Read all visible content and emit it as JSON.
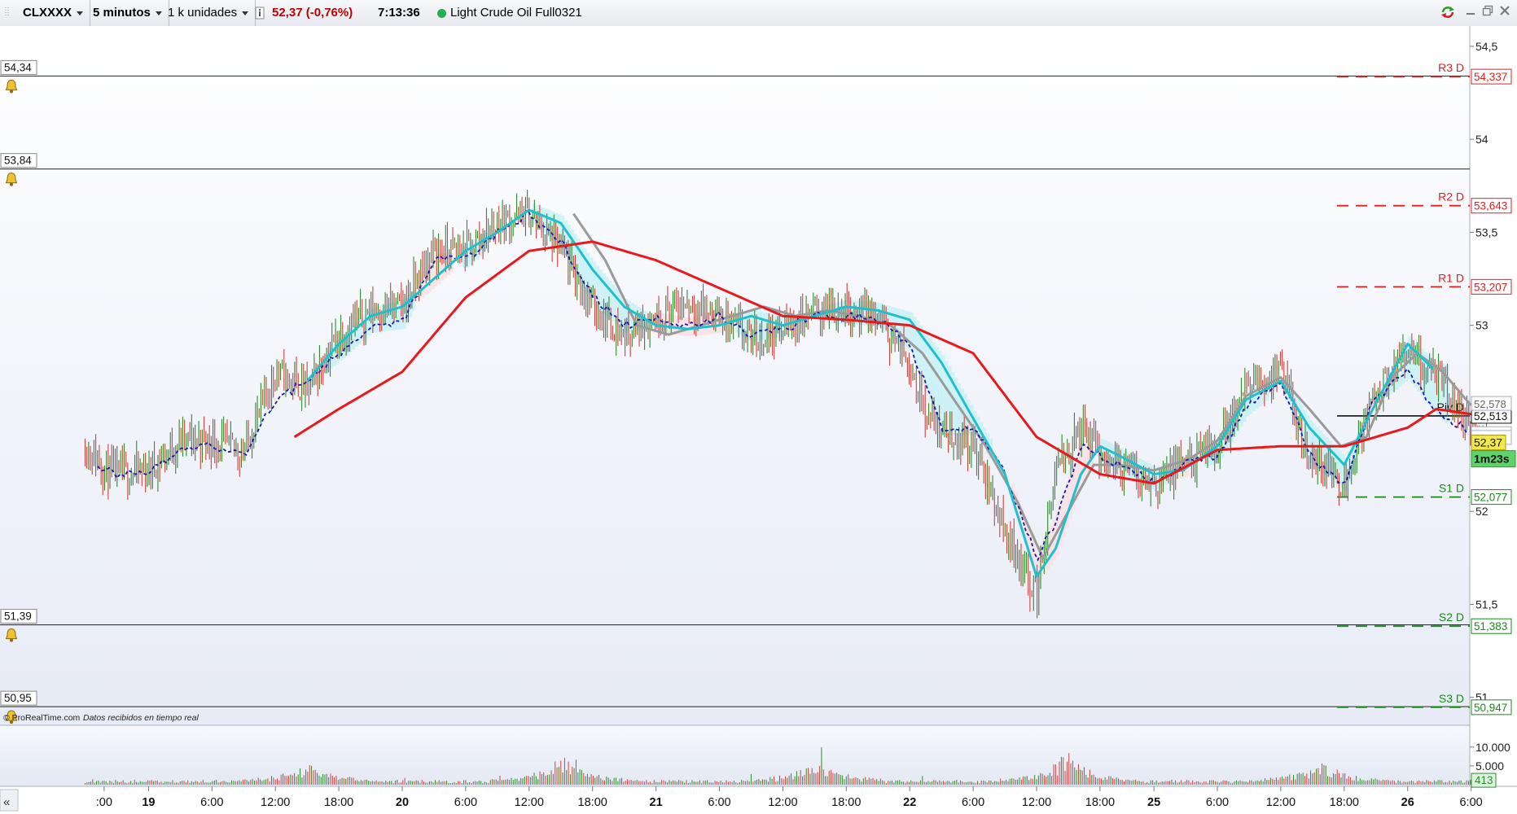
{
  "toolbar": {
    "symbol": "CLXXXX",
    "interval": "5 minutos",
    "units": "1 k unidades",
    "price_change": "52,37 (-0,76%)",
    "time": "7:13:36",
    "instrument": "Light Crude Oil Full0321"
  },
  "footer": {
    "brand": "© ProRealTime.com",
    "status": "Datos recibidos en tiempo real",
    "timer": "1m23s"
  },
  "colors": {
    "bull": "#2e8b2e",
    "bear": "#d04040",
    "cyan": "#1fc0cc",
    "red_ma": "#e8191c",
    "gray_ma": "#9a9a9a",
    "blue_dash": "#1a1aa8",
    "resistance": "#e02020",
    "support": "#1a8a1a"
  },
  "chart_data": {
    "type": "line",
    "title": "Light Crude Oil Full0321",
    "ylim": [
      50.85,
      54.6
    ],
    "y_ticks": [
      {
        "v": 54.5,
        "label": "54,5"
      },
      {
        "v": 54,
        "label": "54"
      },
      {
        "v": 53.5,
        "label": "53,5"
      },
      {
        "v": 53,
        "label": "53"
      },
      {
        "v": 52,
        "label": "52"
      },
      {
        "v": 51.5,
        "label": "51,5"
      },
      {
        "v": 51,
        "label": "51"
      }
    ],
    "x_ticks": [
      {
        "x": 0.3,
        "label": ":00",
        "bold": false
      },
      {
        "x": 1,
        "label": "19",
        "bold": true
      },
      {
        "x": 2,
        "label": "6:00",
        "bold": false
      },
      {
        "x": 3,
        "label": "12:00",
        "bold": false
      },
      {
        "x": 4,
        "label": "18:00",
        "bold": false
      },
      {
        "x": 5,
        "label": "20",
        "bold": true
      },
      {
        "x": 6,
        "label": "6:00",
        "bold": false
      },
      {
        "x": 7,
        "label": "12:00",
        "bold": false
      },
      {
        "x": 8,
        "label": "18:00",
        "bold": false
      },
      {
        "x": 9,
        "label": "21",
        "bold": true
      },
      {
        "x": 10,
        "label": "6:00",
        "bold": false
      },
      {
        "x": 11,
        "label": "12:00",
        "bold": false
      },
      {
        "x": 12,
        "label": "18:00",
        "bold": false
      },
      {
        "x": 13,
        "label": "22",
        "bold": true
      },
      {
        "x": 14,
        "label": "6:00",
        "bold": false
      },
      {
        "x": 15,
        "label": "12:00",
        "bold": false
      },
      {
        "x": 16,
        "label": "18:00",
        "bold": false
      },
      {
        "x": 16.85,
        "label": "25",
        "bold": true
      },
      {
        "x": 17.85,
        "label": "6:00",
        "bold": false
      },
      {
        "x": 18.85,
        "label": "12:00",
        "bold": false
      },
      {
        "x": 19.85,
        "label": "18:00",
        "bold": false
      },
      {
        "x": 20.85,
        "label": "26",
        "bold": true
      },
      {
        "x": 21.85,
        "label": "6:00",
        "bold": false
      }
    ],
    "alert_lines": [
      {
        "value": 54.34,
        "label": "54,34"
      },
      {
        "value": 53.84,
        "label": "53,84"
      },
      {
        "value": 51.39,
        "label": "51,39"
      },
      {
        "value": 50.95,
        "label": "50,95"
      }
    ],
    "pivot_levels": [
      {
        "name": "R3 D",
        "value": 54.337,
        "label": "54,337",
        "kind": "resistance"
      },
      {
        "name": "R2 D",
        "value": 53.643,
        "label": "53,643",
        "kind": "resistance"
      },
      {
        "name": "R1 D",
        "value": 53.207,
        "label": "53,207",
        "kind": "resistance"
      },
      {
        "name": "Piv D",
        "value": 52.513,
        "label": "52,513",
        "kind": "pivot"
      },
      {
        "name": "S1 D",
        "value": 52.077,
        "label": "52,077",
        "kind": "support"
      },
      {
        "name": "S2 D",
        "value": 51.383,
        "label": "51,383",
        "kind": "support"
      },
      {
        "name": "S3 D",
        "value": 50.947,
        "label": "50,947",
        "kind": "support"
      }
    ],
    "indicator_labels": [
      {
        "value": 52.578,
        "label": "52,578",
        "color": "#666666"
      },
      {
        "value": 52.42,
        "label": "52,405",
        "color": "#2020a0"
      },
      {
        "value": 52.395,
        "label": "52,395",
        "color": "#666666"
      }
    ],
    "last_price": {
      "value": 52.37,
      "label": "52,37"
    },
    "price": {
      "x": [
        0,
        0.4,
        1,
        1.5,
        2,
        2.5,
        3,
        3.5,
        4,
        4.5,
        5,
        5.5,
        6,
        6.5,
        7,
        7.5,
        8,
        8.5,
        9,
        9.5,
        10,
        10.5,
        11,
        11.5,
        12,
        12.5,
        13,
        13.3,
        13.7,
        14,
        14.5,
        15,
        15.3,
        15.7,
        16,
        16.3,
        16.85,
        17.3,
        17.85,
        18.3,
        18.85,
        19.3,
        19.85,
        20.3,
        20.85,
        21.3,
        21.85,
        22.1
      ],
      "y": [
        52.35,
        52.2,
        52.22,
        52.38,
        52.38,
        52.32,
        52.75,
        52.65,
        52.95,
        53.08,
        53.1,
        53.4,
        53.4,
        53.55,
        53.6,
        53.4,
        53.1,
        52.95,
        53.05,
        53.12,
        53.05,
        52.92,
        52.98,
        53.08,
        53.1,
        53.03,
        52.8,
        52.5,
        52.4,
        52.35,
        51.9,
        51.55,
        52.2,
        52.45,
        52.3,
        52.25,
        52.15,
        52.25,
        52.35,
        52.65,
        52.75,
        52.3,
        52.15,
        52.6,
        52.85,
        52.72,
        52.45,
        52.37
      ]
    },
    "series": [
      {
        "name": "moving-average-slow",
        "color": "#e8191c",
        "x": [
          3.3,
          4,
          5,
          6,
          7,
          8,
          9,
          10,
          11,
          12,
          13,
          14,
          15,
          15.5,
          16,
          16.85,
          17.85,
          18.85,
          19.85,
          20.85,
          21.3,
          21.9
        ],
        "y": [
          52.4,
          52.55,
          52.75,
          53.15,
          53.4,
          53.45,
          53.35,
          53.2,
          53.05,
          53.03,
          53.0,
          52.85,
          52.4,
          52.3,
          52.2,
          52.15,
          52.33,
          52.35,
          52.35,
          52.45,
          52.55,
          52.52
        ]
      },
      {
        "name": "moving-average-fast",
        "color": "#1fc0cc",
        "x": [
          3.5,
          4,
          4.5,
          5,
          5.5,
          6,
          6.5,
          7,
          7.5,
          8,
          8.5,
          9,
          9.5,
          10,
          10.5,
          11,
          11.5,
          12,
          12.5,
          13,
          13.5,
          14,
          14.5,
          15,
          15.3,
          15.7,
          16,
          16.3,
          16.85,
          17.3,
          17.85,
          18.3,
          18.85,
          19.3,
          19.85,
          20.3,
          20.85,
          21.3
        ],
        "y": [
          52.7,
          52.9,
          53.05,
          53.1,
          53.25,
          53.4,
          53.5,
          53.62,
          53.55,
          53.3,
          53.1,
          53.0,
          52.98,
          53.0,
          53.05,
          53.0,
          53.05,
          53.1,
          53.08,
          53.03,
          52.8,
          52.5,
          52.2,
          51.65,
          51.8,
          52.2,
          52.35,
          52.3,
          52.2,
          52.22,
          52.35,
          52.6,
          52.7,
          52.45,
          52.25,
          52.55,
          52.9,
          52.75
        ]
      },
      {
        "name": "moving-average-gray",
        "color": "#9a9a9a",
        "x": [
          7.7,
          8.2,
          8.7,
          9.2,
          9.7,
          10.2,
          10.7,
          11.2,
          11.7,
          12.2,
          12.7,
          13.2,
          13.7,
          14.2,
          14.7,
          15.1,
          15.5,
          15.9,
          16.3,
          16.85,
          17.4,
          17.85,
          18.3,
          18.85,
          19.3,
          19.8,
          20.2,
          20.6,
          21,
          21.4,
          21.9
        ],
        "y": [
          53.6,
          53.35,
          53.0,
          52.95,
          53.0,
          53.05,
          53.1,
          53.05,
          53.08,
          53.05,
          53.0,
          52.85,
          52.6,
          52.35,
          52.05,
          51.75,
          52.0,
          52.25,
          52.25,
          52.22,
          52.28,
          52.38,
          52.62,
          52.72,
          52.55,
          52.35,
          52.4,
          52.72,
          52.85,
          52.75,
          52.55
        ]
      },
      {
        "name": "moving-average-dashed",
        "color": "#1a1aa8",
        "x": [
          0.2,
          0.5,
          1,
          1.5,
          2,
          2.5,
          3,
          3.5,
          4,
          4.5,
          5,
          5.5,
          6,
          6.5,
          7,
          7.5,
          8,
          8.5,
          9,
          9.5,
          10,
          10.5,
          11,
          11.5,
          12,
          12.5,
          13,
          13.5,
          14,
          14.5,
          15,
          15.3,
          15.7,
          16,
          16.3,
          16.85,
          17.3,
          17.85,
          18.3,
          18.85,
          19.3,
          19.85,
          20.3,
          20.85,
          21.3,
          21.85
        ],
        "y": [
          52.25,
          52.2,
          52.2,
          52.35,
          52.35,
          52.3,
          52.6,
          52.7,
          52.85,
          53.0,
          53.02,
          53.35,
          53.35,
          53.5,
          53.6,
          53.45,
          53.15,
          53.0,
          53.03,
          53.0,
          53.05,
          52.95,
          52.98,
          53.05,
          53.05,
          53.03,
          52.9,
          52.45,
          52.45,
          52.2,
          51.75,
          51.95,
          52.35,
          52.3,
          52.25,
          52.15,
          52.25,
          52.3,
          52.55,
          52.7,
          52.3,
          52.15,
          52.6,
          52.75,
          52.55,
          52.42
        ]
      }
    ],
    "volume": {
      "y_ticks": [
        {
          "v": 10000,
          "label": "10.000"
        },
        {
          "v": 5000,
          "label": "5.000"
        }
      ],
      "last": {
        "value": 413,
        "label": "413"
      },
      "ylim": [
        0,
        13000
      ],
      "peaks": [
        {
          "x": 3.5,
          "value": 8200
        },
        {
          "x": 7.5,
          "value": 11000
        },
        {
          "x": 11.5,
          "value": 9000
        },
        {
          "x": 15.5,
          "value": 12000
        },
        {
          "x": 19.5,
          "value": 9000
        }
      ]
    }
  }
}
